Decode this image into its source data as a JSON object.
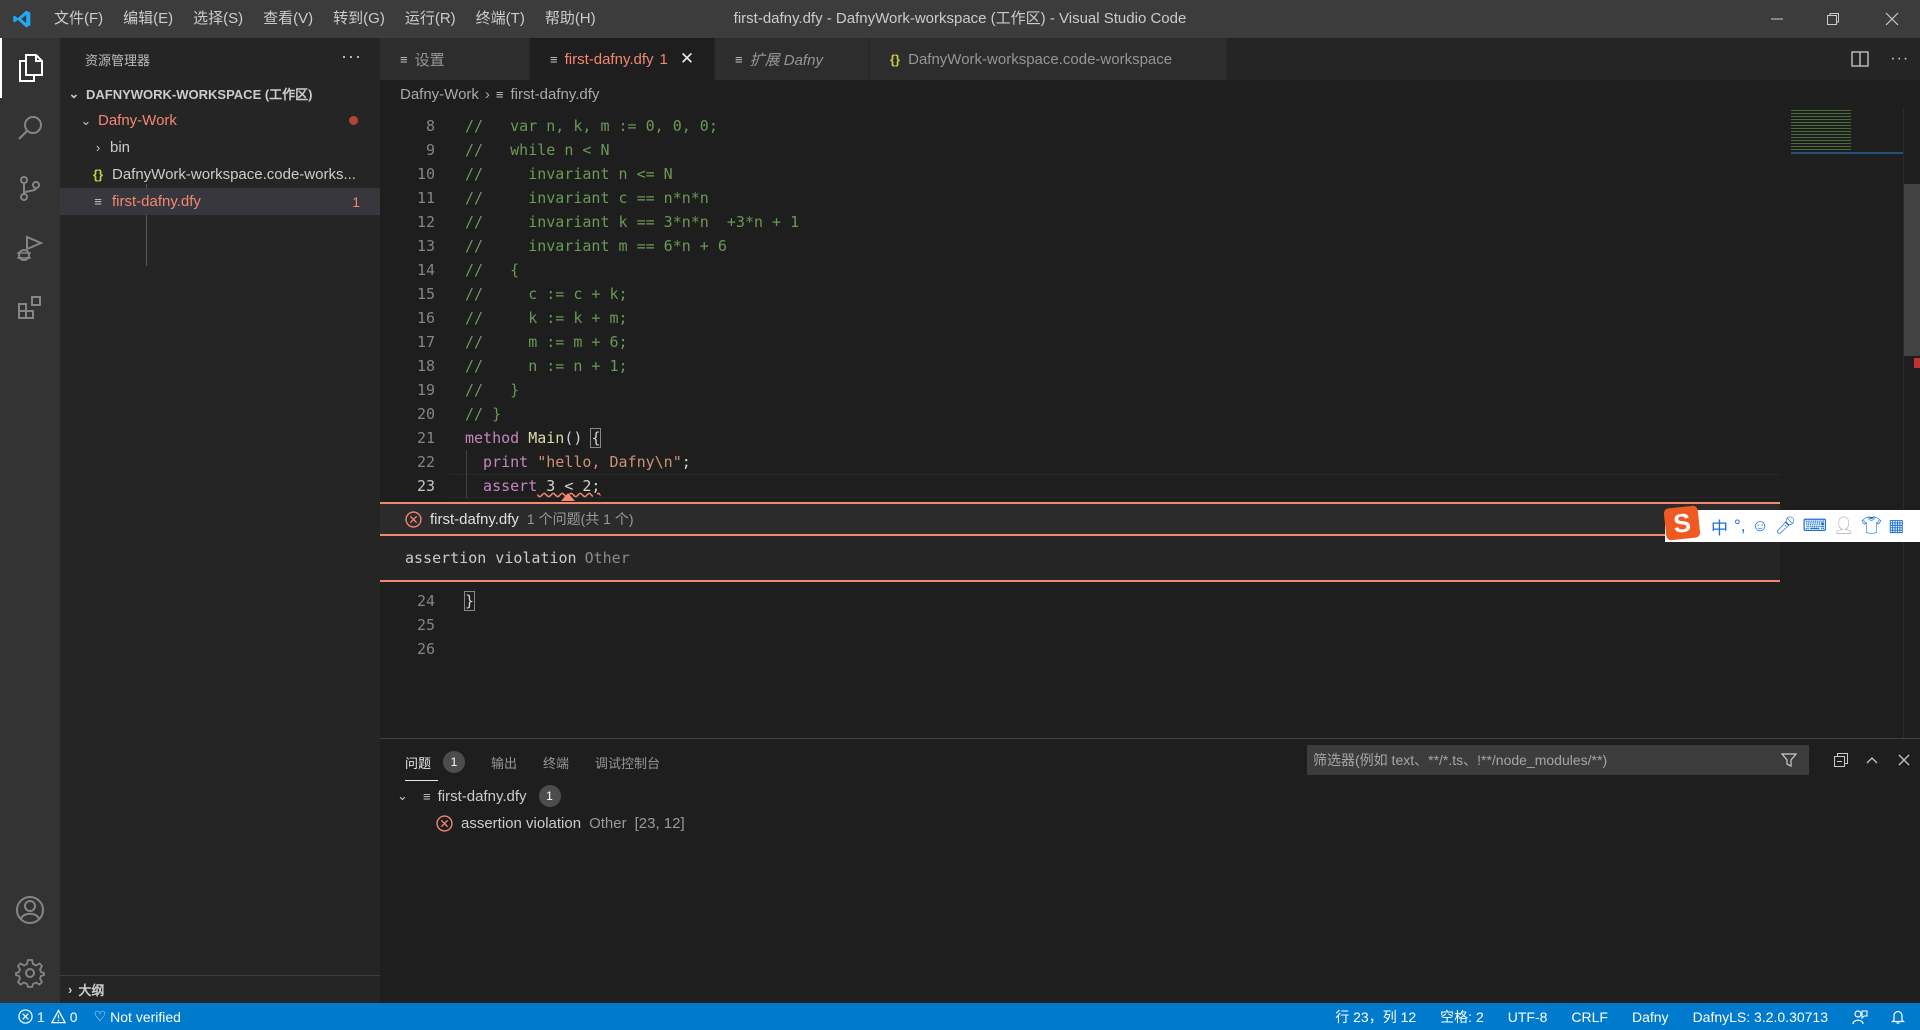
{
  "titlebar": {
    "menu": [
      "文件(F)",
      "编辑(E)",
      "选择(S)",
      "查看(V)",
      "转到(G)",
      "运行(R)",
      "终端(T)",
      "帮助(H)"
    ],
    "window_title": "first-dafny.dfy - DafnyWork-workspace (工作区) - Visual Studio Code"
  },
  "sidebar": {
    "title": "资源管理器",
    "more": "···",
    "workspace": "DAFNYWORK-WORKSPACE (工作区)",
    "folder": "Dafny-Work",
    "items": [
      {
        "label": "bin",
        "type": "folder"
      },
      {
        "label": "DafnyWork-workspace.code-works...",
        "type": "json"
      },
      {
        "label": "first-dafny.dfy",
        "type": "file",
        "problems": "1"
      }
    ],
    "outline": "大纲"
  },
  "tabs": [
    {
      "label": "设置",
      "active": false
    },
    {
      "label": "first-dafny.dfy",
      "badge": "1",
      "active": true
    },
    {
      "label": "扩展 Dafny",
      "active": false,
      "italic": true
    },
    {
      "label": "DafnyWork-workspace.code-workspace",
      "active": false
    }
  ],
  "breadcrumb": [
    "Dafny-Work",
    "first-dafny.dfy"
  ],
  "editor": {
    "lines": [
      {
        "n": "8",
        "text": "//   var n, k, m := 0, 0, 0;"
      },
      {
        "n": "9",
        "text": "//   while n < N"
      },
      {
        "n": "10",
        "text": "//     invariant n <= N"
      },
      {
        "n": "11",
        "text": "//     invariant c == n*n*n"
      },
      {
        "n": "12",
        "text": "//     invariant k == 3*n*n  +3*n + 1"
      },
      {
        "n": "13",
        "text": "//     invariant m == 6*n + 6"
      },
      {
        "n": "14",
        "text": "//   {"
      },
      {
        "n": "15",
        "text": "//     c := c + k;"
      },
      {
        "n": "16",
        "text": "//     k := k + m;"
      },
      {
        "n": "17",
        "text": "//     m := m + 6;"
      },
      {
        "n": "18",
        "text": "//     n := n + 1;"
      },
      {
        "n": "19",
        "text": "//   }"
      },
      {
        "n": "20",
        "text": "// }"
      },
      {
        "n": "21",
        "kw": "method",
        "fn": "Main",
        "rest": "() ",
        "brace": "{"
      },
      {
        "n": "22",
        "kw": "  print",
        "str": "\"hello, Dafny\\n\"",
        "rest": ";"
      },
      {
        "n": "23",
        "kw": "  assert",
        "rest": " 3 < 2;"
      },
      {
        "n": "24",
        "brace": "}"
      },
      {
        "n": "25"
      },
      {
        "n": "26"
      }
    ],
    "peek": {
      "file": "first-dafny.dfy",
      "summary": "1 个问题(共 1 个)",
      "message": "assertion violation",
      "source": "Other"
    }
  },
  "ime": {
    "items": [
      "中",
      "°,",
      "☺",
      "mic",
      "keyboard",
      "user",
      "shirt",
      "apps"
    ]
  },
  "panel": {
    "tabs": [
      {
        "label": "问题",
        "badge": "1",
        "active": true
      },
      {
        "label": "输出"
      },
      {
        "label": "终端"
      },
      {
        "label": "调试控制台"
      }
    ],
    "filter_placeholder": "筛选器(例如 text、**/*.ts、!**/node_modules/**)",
    "file": "first-dafny.dfy",
    "file_count": "1",
    "problem": {
      "message": "assertion violation",
      "source": "Other",
      "location": "[23, 12]"
    }
  },
  "status": {
    "errors": "1",
    "warnings": "0",
    "verification": "Not verified",
    "position": "行 23，列 12",
    "spaces": "空格: 2",
    "encoding": "UTF-8",
    "eol": "CRLF",
    "language": "Dafny",
    "ls_version": "DafnyLS: 3.2.0.30713"
  },
  "colors": {
    "accent": "#007acc",
    "error": "#f48771",
    "comment": "#6a9955",
    "keyword": "#c586c0"
  }
}
